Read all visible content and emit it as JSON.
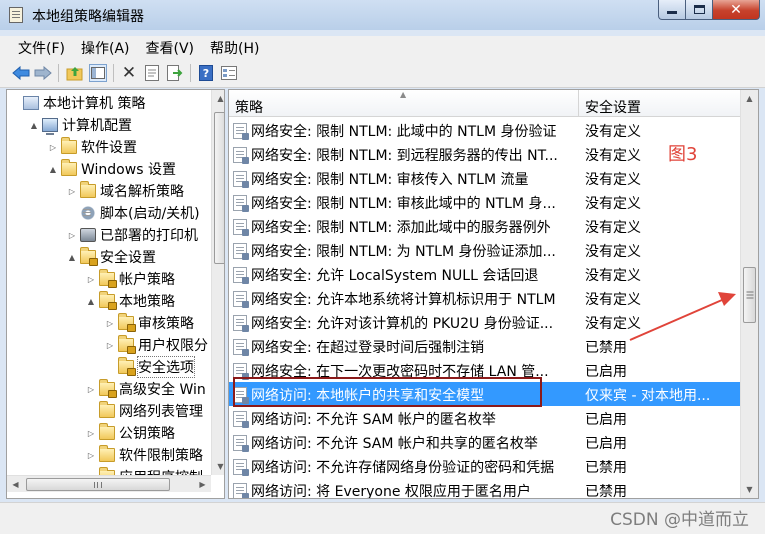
{
  "window": {
    "title": "本地组策略编辑器"
  },
  "menu": {
    "items": [
      "文件(F)",
      "操作(A)",
      "查看(V)",
      "帮助(H)"
    ]
  },
  "toolbar": {
    "icons": [
      "back-arrow-icon",
      "forward-arrow-icon",
      "up-folder-icon",
      "show-hide-tree-icon",
      "delete-icon",
      "properties-icon",
      "export-list-icon",
      "help-icon",
      "view-icon"
    ]
  },
  "tree": {
    "nodes": [
      {
        "label": "本地计算机 策略",
        "icon": "policy-book-icon",
        "toggle": "",
        "indent": 0
      },
      {
        "label": "计算机配置",
        "icon": "computer-icon",
        "toggle": "▲",
        "indent": 1
      },
      {
        "label": "软件设置",
        "icon": "folder-icon",
        "toggle": "▷",
        "indent": 2
      },
      {
        "label": "Windows 设置",
        "icon": "folder-icon",
        "toggle": "▲",
        "indent": 2
      },
      {
        "label": "域名解析策略",
        "icon": "folder-icon",
        "toggle": "▷",
        "indent": 3
      },
      {
        "label": "脚本(启动/关机)",
        "icon": "script-icon",
        "toggle": "",
        "indent": 3
      },
      {
        "label": "已部署的打印机",
        "icon": "printer-icon",
        "toggle": "▷",
        "indent": 3
      },
      {
        "label": "安全设置",
        "icon": "folder-lock-icon",
        "toggle": "▲",
        "indent": 3
      },
      {
        "label": "帐户策略",
        "icon": "folder-lock-icon",
        "toggle": "▷",
        "indent": 4
      },
      {
        "label": "本地策略",
        "icon": "folder-lock-icon",
        "toggle": "▲",
        "indent": 4
      },
      {
        "label": "审核策略",
        "icon": "folder-lock-icon",
        "toggle": "▷",
        "indent": 5
      },
      {
        "label": "用户权限分",
        "icon": "folder-lock-icon",
        "toggle": "▷",
        "indent": 5
      },
      {
        "label": "安全选项",
        "icon": "folder-lock-icon",
        "toggle": "",
        "indent": 5,
        "selected": true
      },
      {
        "label": "高级安全 Win",
        "icon": "folder-lock-icon",
        "toggle": "▷",
        "indent": 4
      },
      {
        "label": "网络列表管理",
        "icon": "folder-icon",
        "toggle": "",
        "indent": 4
      },
      {
        "label": "公钥策略",
        "icon": "folder-icon",
        "toggle": "▷",
        "indent": 4
      },
      {
        "label": "软件限制策略",
        "icon": "folder-icon",
        "toggle": "▷",
        "indent": 4
      },
      {
        "label": "应用程序控制",
        "icon": "folder-icon",
        "toggle": "▷",
        "indent": 4
      }
    ]
  },
  "list": {
    "columns": [
      "策略",
      "安全设置"
    ],
    "rows": [
      {
        "policy": "网络安全: 限制 NTLM: 此域中的 NTLM 身份验证",
        "setting": "没有定义"
      },
      {
        "policy": "网络安全: 限制 NTLM: 到远程服务器的传出 NT...",
        "setting": "没有定义"
      },
      {
        "policy": "网络安全: 限制 NTLM: 审核传入 NTLM 流量",
        "setting": "没有定义"
      },
      {
        "policy": "网络安全: 限制 NTLM: 审核此域中的 NTLM 身...",
        "setting": "没有定义"
      },
      {
        "policy": "网络安全: 限制 NTLM: 添加此域中的服务器例外",
        "setting": "没有定义"
      },
      {
        "policy": "网络安全: 限制 NTLM: 为 NTLM 身份验证添加...",
        "setting": "没有定义"
      },
      {
        "policy": "网络安全: 允许 LocalSystem NULL 会话回退",
        "setting": "没有定义"
      },
      {
        "policy": "网络安全: 允许本地系统将计算机标识用于 NTLM",
        "setting": "没有定义"
      },
      {
        "policy": "网络安全: 允许对该计算机的 PKU2U 身份验证...",
        "setting": "没有定义"
      },
      {
        "policy": "网络安全: 在超过登录时间后强制注销",
        "setting": "已禁用"
      },
      {
        "policy": "网络安全: 在下一次更改密码时不存储 LAN 管...",
        "setting": "已启用"
      },
      {
        "policy": "网络访问: 本地帐户的共享和安全模型",
        "setting": "仅来宾 - 对本地用...",
        "selected": true
      },
      {
        "policy": "网络访问: 不允许 SAM 帐户的匿名枚举",
        "setting": "已启用"
      },
      {
        "policy": "网络访问: 不允许 SAM 帐户和共享的匿名枚举",
        "setting": "已启用"
      },
      {
        "policy": "网络访问: 不允许存储网络身份验证的密码和凭据",
        "setting": "已禁用"
      },
      {
        "policy": "网络访问: 将 Everyone 权限应用于匿名用户",
        "setting": "已禁用"
      }
    ]
  },
  "annotation": {
    "label": "图3",
    "color": "#e0443a",
    "box_color": "#8b1a1a"
  },
  "watermark": "CSDN @中道而立",
  "colors": {
    "selection": "#3399ff",
    "title_bar": "#c3d6ee"
  }
}
